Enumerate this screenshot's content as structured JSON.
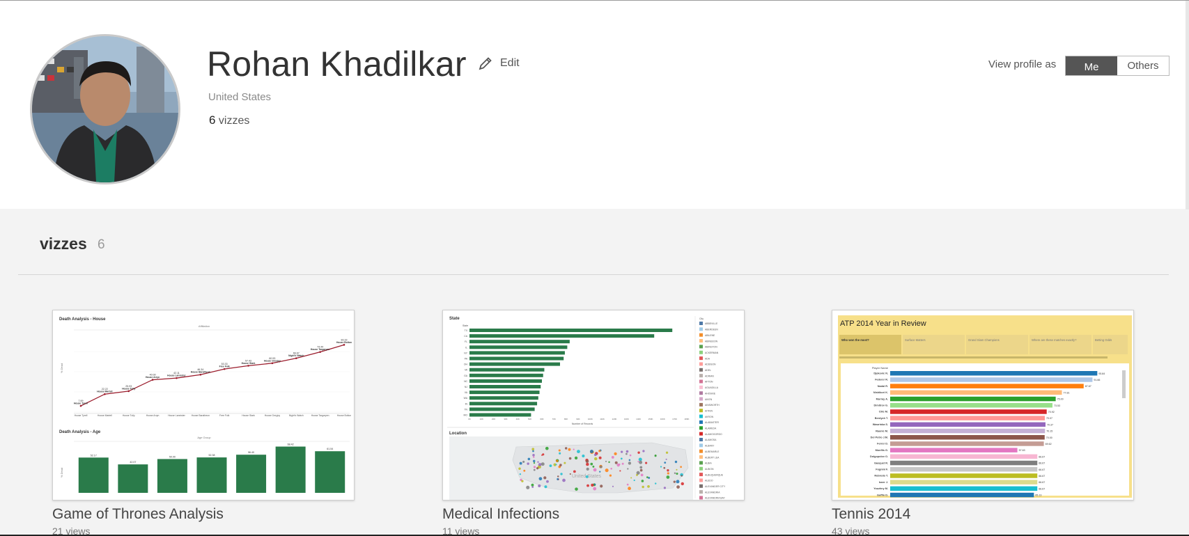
{
  "profile": {
    "name": "Rohan Khadilkar",
    "edit_label": "Edit",
    "country": "United States",
    "vizzes_count": "6",
    "vizzes_word": "vizzes"
  },
  "view_profile": {
    "label": "View profile as",
    "options": [
      "Me",
      "Others"
    ],
    "selected": "Me"
  },
  "section": {
    "title": "vizzes",
    "count": "6"
  },
  "colors": {
    "viz_green": "#2a7b4a",
    "line_red": "#9b1c2c",
    "tennis_yellow": "#f7e08a"
  },
  "vizzes": [
    {
      "title": "Game of Thrones Analysis",
      "views": "21 views",
      "thumb": {
        "top_title": "Death Analysis - House",
        "top_sub": "Affiliation",
        "top_ylabel": "% Dead",
        "bottom_title": "Death Analysis - Age",
        "bottom_sub": "Age Group",
        "bottom_ylabel": "% Dead",
        "line_values": [
          7.69,
          22.22,
          25.93,
          40.0,
          42.11,
          46.34,
          53.33,
          57.43,
          60.53,
          66.67,
          74.44,
          83.33
        ],
        "line_labels": [
          "House Tyrell",
          "House Martell",
          "House Tully",
          "House Arryn",
          "House Lannister",
          "House Baratheon",
          "Free Folk",
          "House Stark",
          "House Greyjoy",
          "Night's Watch",
          "House Targaryen",
          "House Bolton"
        ],
        "bar_values": [
          52.17,
          42.07,
          50.0,
          52.38,
          56.4,
          68.42,
          61.54
        ]
      }
    },
    {
      "title": "Medical Infections",
      "views": "11 views",
      "thumb": {
        "top_title": "State",
        "state_header": "State",
        "states": [
          "TX",
          "CA",
          "FL",
          "IL",
          "NY",
          "PA",
          "OH",
          "MI",
          "GA",
          "NC",
          "NJ",
          "VA",
          "WA",
          "IN",
          "TN",
          "MO"
        ],
        "state_values": [
          168,
          153,
          83,
          81,
          79,
          78,
          75,
          62,
          61,
          60,
          59,
          58,
          57,
          56,
          54,
          51
        ],
        "x_ticks": [
          "0K",
          "10K",
          "20K",
          "30K",
          "40K",
          "50K",
          "60K",
          "70K",
          "80K",
          "90K",
          "100K",
          "110K",
          "120K",
          "130K",
          "140K",
          "150K",
          "160K",
          "170K",
          "180K"
        ],
        "x_label": "Number of Records",
        "bottom_title": "Location",
        "map_label": "United States",
        "legend_title": "City",
        "legend": [
          "ABBEVILLE",
          "ABERDEEN",
          "ABILENE",
          "ABINGDON",
          "ABINGTON",
          "ACKERMAN",
          "ADA",
          "ADDISON",
          "ADEL",
          "ADRIAN",
          "AFTON",
          "AGUADILLA",
          "AHOSKIE",
          "AIKEN",
          "AINSWORTH",
          "AITKIN",
          "AKRON",
          "ALABASTER",
          "ALAMEDA",
          "ALAMOGORDO",
          "ALAMOSA",
          "ALBANY",
          "ALBEMARLE",
          "ALBERT LEA",
          "ALBIA",
          "ALBION",
          "ALBUQUERQUE",
          "ALEDO",
          "ALEXANDER CITY",
          "ALEXANDRIA",
          "ALEXANDRIA BAY"
        ]
      }
    },
    {
      "title": "Tennis 2014",
      "views": "43 views",
      "thumb": {
        "banner": "ATP 2014 Year in Review",
        "tabs": [
          "Who won the most?",
          "Surface Matters",
          "Grand Slam Champions",
          "Where are these matches exactly?",
          "Betting Odds"
        ],
        "col_header": "Player Name",
        "players": [
          "Djokovic N.",
          "Federer R.",
          "Nadal R.",
          "Nishikori K.",
          "Murray A.",
          "Dimitrov G.",
          "Cilic M.",
          "Berdych T.",
          "Wawrinka S.",
          "Raonic M.",
          "Del Potro J.M.",
          "Ferrer D.",
          "Monfils G.",
          "Dolgopolov O.",
          "Gasquet R.",
          "Fognini F.",
          "Robredo T.",
          "Isner J.",
          "Youzhny M.",
          "Goffin D."
        ],
        "values": [
          93.84,
          91.66,
          87.67,
          77.81,
          75.0,
          73.53,
          70.92,
          70.07,
          70.37,
          70.15,
          70.0,
          69.62,
          57.63,
          66.67,
          66.67,
          66.67,
          66.67,
          66.67,
          66.67,
          65.13
        ]
      }
    }
  ]
}
